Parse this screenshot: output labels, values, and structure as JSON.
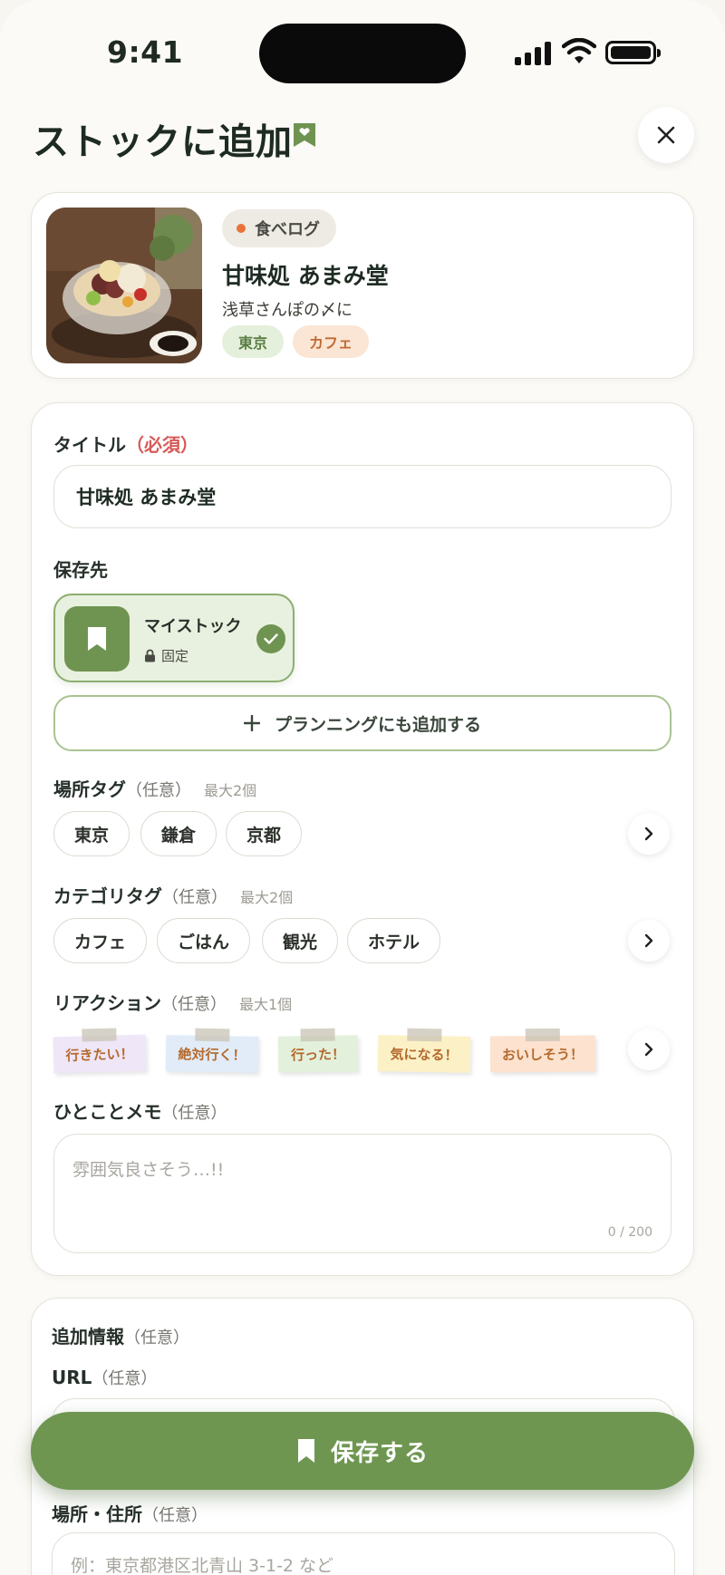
{
  "status_bar": {
    "time": "9:41"
  },
  "header": {
    "title": "ストックに追加"
  },
  "source": {
    "badge": "食べログ",
    "name": "甘味処 あまみ堂",
    "subtitle": "浅草さんぽの〆に",
    "tags": [
      "東京",
      "カフェ"
    ]
  },
  "form": {
    "title_label": "タイトル",
    "title_required": "（必須）",
    "title_value": "甘味処 あまみ堂",
    "destination_label": "保存先",
    "destination_name": "マイストック",
    "destination_fixed": "固定",
    "planning_button": "プランニングにも追加する",
    "place_tags": {
      "label": "場所タグ",
      "optional": "（任意）",
      "max": "最大2個",
      "items": [
        "東京",
        "鎌倉",
        "京都"
      ]
    },
    "category_tags": {
      "label": "カテゴリタグ",
      "optional": "（任意）",
      "max": "最大2個",
      "items": [
        "カフェ",
        "ごはん",
        "観光",
        "ホテル"
      ]
    },
    "reactions": {
      "label": "リアクション",
      "optional": "（任意）",
      "max": "最大1個",
      "items": [
        "行きたい！",
        "絶対行く！",
        "行った！",
        "気になる！",
        "おいしそう！"
      ]
    },
    "memo": {
      "label": "ひとことメモ",
      "optional": "（任意）",
      "placeholder": "雰囲気良さそう…!!",
      "count": "0 / 200"
    }
  },
  "extra": {
    "label": "追加情報",
    "optional": "（任意）",
    "url_label": "URL",
    "url_optional": "（任意）",
    "address_label": "場所・住所",
    "address_optional": "（任意）",
    "address_placeholder": "例：東京都港区北青山 3-1-2 など"
  },
  "save_button": "保存する",
  "colors": {
    "accent_green": "#6E9650",
    "required_red": "#D65A57",
    "source_dot": "#E8733A",
    "note_colors": [
      "#EFE6F7",
      "#E1ECF8",
      "#E3F1DC",
      "#FCF1C6",
      "#FCE2CF"
    ],
    "note_text_colors": [
      "#B46A2E",
      "#B46A2E",
      "#B46A2E",
      "#B46A2E",
      "#B46A2E"
    ]
  }
}
